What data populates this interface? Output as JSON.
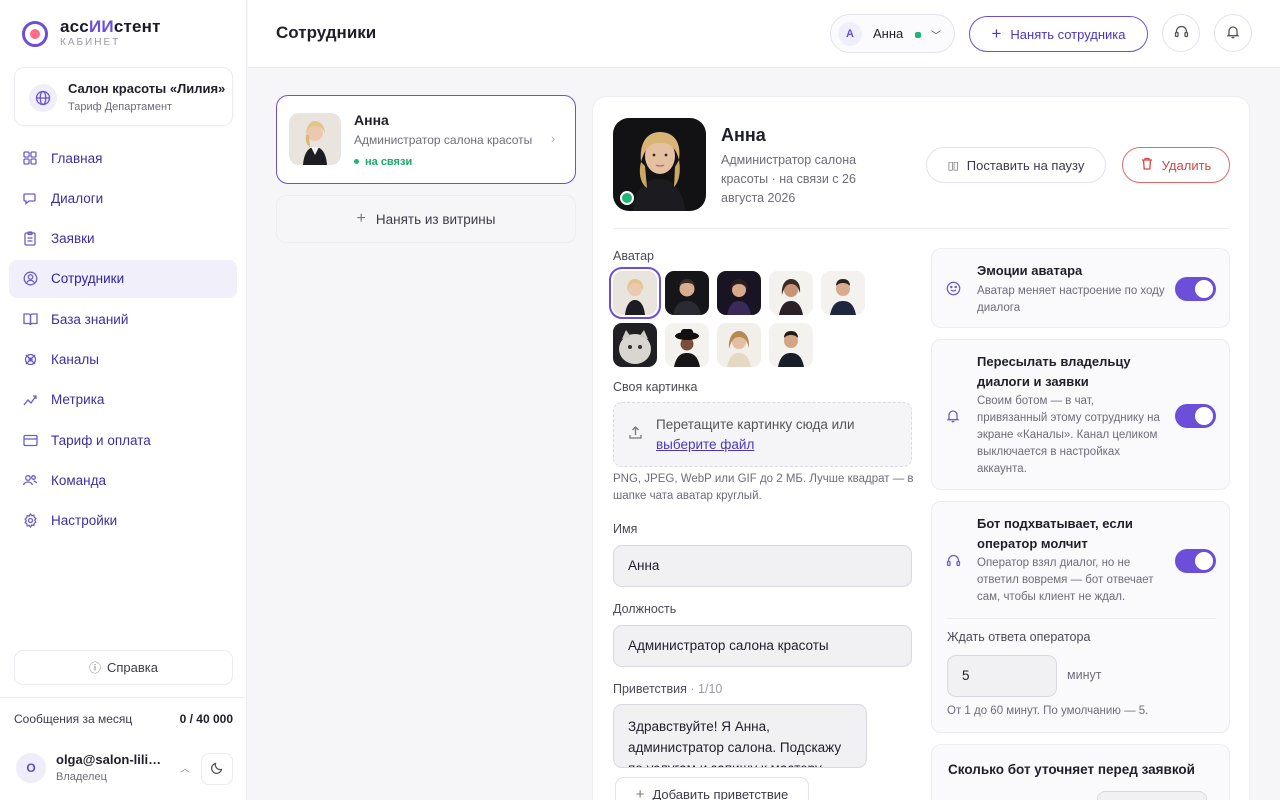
{
  "brand": {
    "name_prefix": "асс",
    "name_accent": "ИИ",
    "name_suffix": "стент",
    "subtitle": "КАБИНЕТ"
  },
  "company": {
    "name": "Салон красоты «Лилия»",
    "plan": "Тариф Департамент",
    "icon": "globe-icon"
  },
  "nav": {
    "items": [
      {
        "label": "Главная",
        "icon": "grid-icon",
        "active": false
      },
      {
        "label": "Диалоги",
        "icon": "chat-icon",
        "active": false
      },
      {
        "label": "Заявки",
        "icon": "clipboard-icon",
        "active": false
      },
      {
        "label": "Сотрудники",
        "icon": "user-circle-icon",
        "active": true
      },
      {
        "label": "База знаний",
        "icon": "book-icon",
        "active": false
      },
      {
        "label": "Каналы",
        "icon": "satellite-icon",
        "active": false
      },
      {
        "label": "Метрика",
        "icon": "chart-icon",
        "active": false
      },
      {
        "label": "Тариф и оплата",
        "icon": "card-icon",
        "active": false
      },
      {
        "label": "Команда",
        "icon": "team-icon",
        "active": false
      },
      {
        "label": "Настройки",
        "icon": "gear-icon",
        "active": false
      }
    ]
  },
  "help": {
    "label": "Справка"
  },
  "usage": {
    "label": "Сообщения за месяц",
    "value": "0 / 40 000"
  },
  "user": {
    "initial": "O",
    "email": "olga@salon-liliya.ru",
    "role": "Владелец"
  },
  "header": {
    "title": "Сотрудники",
    "employee_switch": {
      "initial": "А",
      "name": "Анна"
    },
    "hire_label": "Нанять сотрудника"
  },
  "employee_list": {
    "items": [
      {
        "name": "Анна",
        "role": "Администратор салона красоты",
        "status": "на связи"
      }
    ],
    "showcase_label": "Нанять из витрины"
  },
  "detail": {
    "name": "Анна",
    "description": "Администратор салона красоты · на связи с 26 августа 2026",
    "pause_label": "Поставить на паузу",
    "delete_label": "Удалить",
    "avatar_label": "Аватар",
    "custom_picture_label": "Своя картинка",
    "dropzone_text": "Перетащите картинку сюда или",
    "dropzone_link": "выберите файл",
    "dropzone_hint": "PNG, JPEG, WebP или GIF до 2 МБ. Лучше квадрат — в шапке чата аватар круглый.",
    "name_label": "Имя",
    "name_value": "Анна",
    "position_label": "Должность",
    "position_value": "Администратор салона красоты",
    "greetings_label": "Приветствия",
    "greetings_count": " · 1/10",
    "greeting_text": "Здравствуйте! Я Анна, администратор салона. Подскажу по услугам и запишу к мастеру.",
    "add_greeting_label": "Добавить приветствие"
  },
  "settings": {
    "emotions": {
      "title": "Эмоции аватара",
      "desc": "Аватар меняет настроение по ходу диалога",
      "enabled": true
    },
    "forward": {
      "title": "Пересылать владельцу диалоги и заявки",
      "desc": "Своим ботом — в чат, привязанный этому сотруднику на экране «Каналы». Канал целиком выключается в настройках аккаунта.",
      "enabled": true
    },
    "takeover": {
      "title": "Бот подхватывает, если оператор молчит",
      "desc": "Оператор взял диалог, но не ответил вовремя — бот отвечает сам, чтобы клиент не ждал.",
      "enabled": true,
      "wait_label": "Ждать ответа оператора",
      "wait_value": "5",
      "wait_unit": "минут",
      "wait_hint": "От 1 до 60 минут. По умолчанию — 5."
    },
    "clarify": {
      "title": "Сколько бот уточняет перед заявкой"
    }
  },
  "colors": {
    "accent": "#6b4fd8",
    "online": "#21b573",
    "danger": "#d64545"
  }
}
